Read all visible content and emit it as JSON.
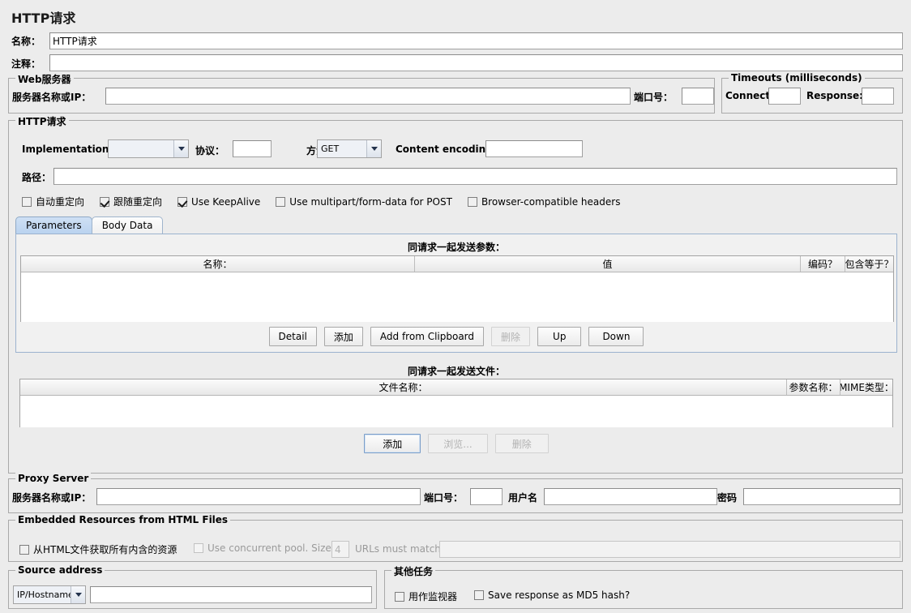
{
  "header": {
    "title": "HTTP请求"
  },
  "name_row": {
    "label": "名称：",
    "value": "HTTP请求"
  },
  "comment_row": {
    "label": "注释：",
    "value": ""
  },
  "web_server": {
    "legend": "Web服务器",
    "server_label": "服务器名称或IP：",
    "server_value": "",
    "port_label": "端口号：",
    "port_value": ""
  },
  "timeouts": {
    "legend": "Timeouts (milliseconds)",
    "connect_label": "Connect:",
    "connect_value": "",
    "response_label": "Response:",
    "response_value": ""
  },
  "http_request": {
    "legend": "HTTP请求",
    "implementation_label": "Implementation:",
    "implementation_value": "",
    "protocol_label": "协议：",
    "protocol_value": "",
    "method_label": "方法：",
    "method_value": "GET",
    "content_encoding_label": "Content encoding:",
    "content_encoding_value": "",
    "path_label": "路径：",
    "path_value": "",
    "checkboxes": [
      {
        "label": "自动重定向",
        "checked": false,
        "enabled": true
      },
      {
        "label": "跟随重定向",
        "checked": true,
        "enabled": true
      },
      {
        "label": "Use KeepAlive",
        "checked": true,
        "enabled": true
      },
      {
        "label": "Use multipart/form-data for POST",
        "checked": false,
        "enabled": true
      },
      {
        "label": "Browser-compatible headers",
        "checked": false,
        "enabled": true
      }
    ]
  },
  "tabs": [
    {
      "label": "Parameters",
      "selected": true
    },
    {
      "label": "Body Data",
      "selected": false
    }
  ],
  "params_panel": {
    "caption": "同请求一起发送参数：",
    "columns": [
      "名称：",
      "值",
      "编码？",
      "包含等于？"
    ],
    "rows": [],
    "buttons": [
      {
        "label": "Detail",
        "enabled": true,
        "focus": false
      },
      {
        "label": "添加",
        "enabled": true,
        "focus": false
      },
      {
        "label": "Add from Clipboard",
        "enabled": true,
        "focus": false
      },
      {
        "label": "删除",
        "enabled": false,
        "focus": false
      },
      {
        "label": "Up",
        "enabled": true,
        "focus": false
      },
      {
        "label": "Down",
        "enabled": true,
        "focus": false
      }
    ]
  },
  "files_panel": {
    "caption": "同请求一起发送文件：",
    "columns": [
      "文件名称：",
      "参数名称：",
      "MIME类型："
    ],
    "rows": [],
    "buttons": [
      {
        "label": "添加",
        "enabled": true,
        "focus": true
      },
      {
        "label": "浏览...",
        "enabled": false,
        "focus": false
      },
      {
        "label": "删除",
        "enabled": false,
        "focus": false
      }
    ]
  },
  "proxy_server": {
    "legend": "Proxy Server",
    "server_label": "服务器名称或IP：",
    "server_value": "",
    "port_label": "端口号：",
    "port_value": "",
    "username_label": "用户名",
    "username_value": "",
    "password_label": "密码",
    "password_value": ""
  },
  "embedded": {
    "legend": "Embedded Resources from HTML Files",
    "retrieve_label": "从HTML文件获取所有内含的资源",
    "retrieve_checked": false,
    "retrieve_enabled": true,
    "pool_label": "Use concurrent pool. Size:",
    "pool_checked": false,
    "pool_enabled": false,
    "pool_size_value": "4",
    "urls_label": "URLs must match:",
    "urls_value": "",
    "urls_enabled": false
  },
  "source_address": {
    "legend": "Source address",
    "type_value": "IP/Hostname",
    "value": ""
  },
  "other_tasks": {
    "legend": "其他任务",
    "checkboxes": [
      {
        "label": "用作监视器",
        "checked": false
      },
      {
        "label": "Save response as MD5 hash?",
        "checked": false
      }
    ]
  }
}
